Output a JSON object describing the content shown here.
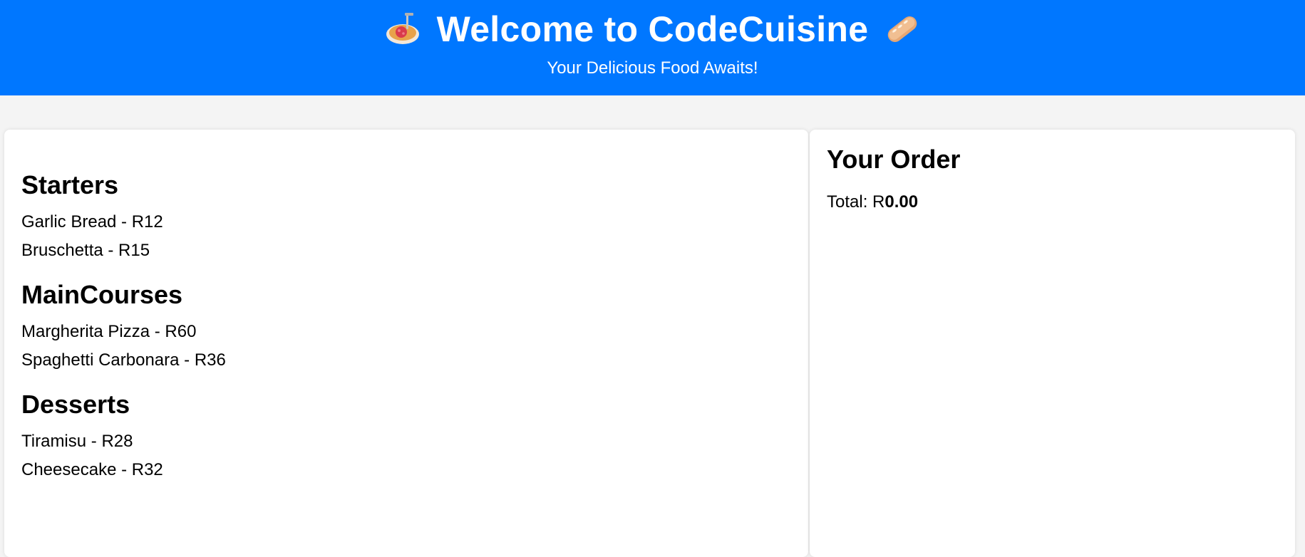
{
  "header": {
    "title": "Welcome to CodeCuisine",
    "subtitle": "Your Delicious Food Awaits!",
    "left_icon": "spaghetti-icon",
    "right_icon": "bread-icon",
    "background_color": "#0077ff"
  },
  "menu": {
    "categories": [
      {
        "name": "Starters",
        "items": [
          "Garlic Bread - R12",
          "Bruschetta - R15"
        ]
      },
      {
        "name": "MainCourses",
        "items": [
          "Margherita Pizza - R60",
          "Spaghetti Carbonara - R36"
        ]
      },
      {
        "name": "Desserts",
        "items": [
          "Tiramisu - R28",
          "Cheesecake - R32"
        ]
      }
    ]
  },
  "order": {
    "title": "Your Order",
    "total_label": "Total: R",
    "total_value": "0.00"
  }
}
